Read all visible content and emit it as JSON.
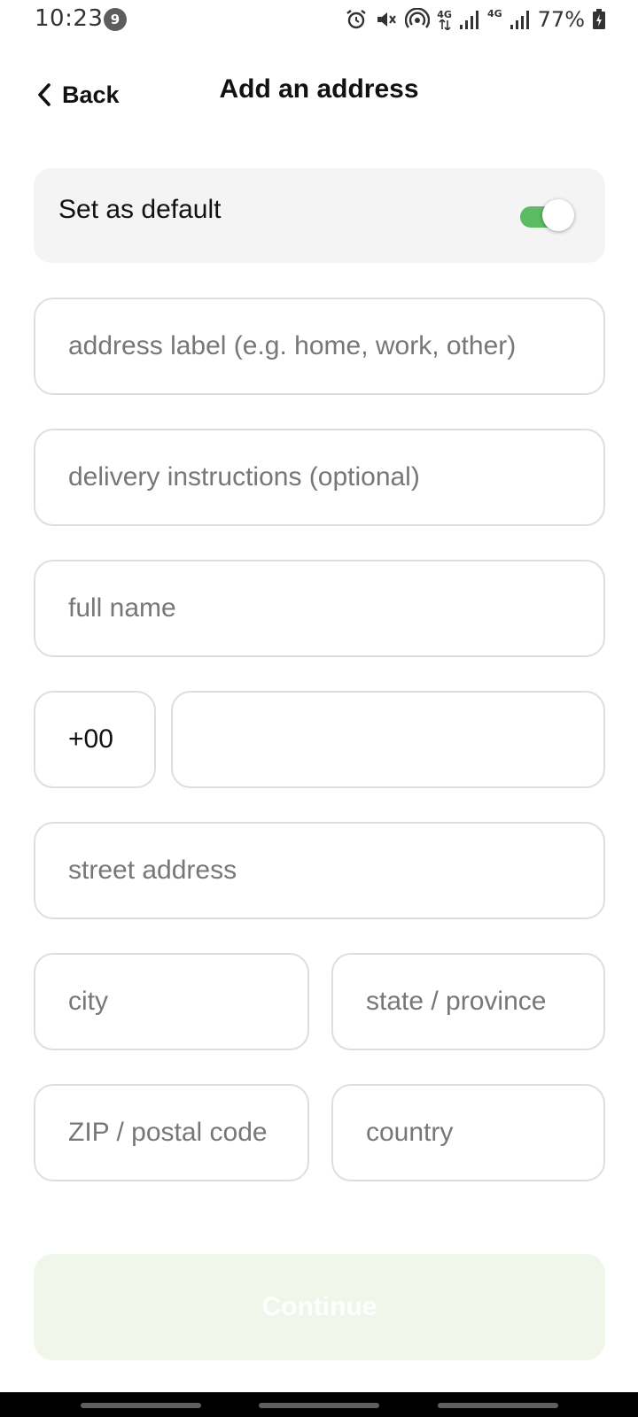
{
  "status_bar": {
    "time": "10:23",
    "notification_count": "9",
    "network_1": "4G",
    "network_2": "4G",
    "battery": "77%"
  },
  "header": {
    "back_label": "Back",
    "title": "Add an address"
  },
  "default_toggle": {
    "label": "Set as default",
    "on": true,
    "on_color": "#5cbb64"
  },
  "form": {
    "address_label": {
      "value": "",
      "placeholder": "address label (e.g. home, work, other)"
    },
    "delivery_instructions": {
      "value": "",
      "placeholder": "delivery instructions (optional)"
    },
    "full_name": {
      "value": "",
      "placeholder": "full name"
    },
    "country_code": {
      "value": "+00"
    },
    "phone": {
      "value": "",
      "placeholder": ""
    },
    "street_address": {
      "value": "",
      "placeholder": "street address"
    },
    "city": {
      "value": "",
      "placeholder": "city"
    },
    "state": {
      "value": "",
      "placeholder": "state / province"
    },
    "zip": {
      "value": "",
      "placeholder": "ZIP / postal code"
    },
    "country": {
      "value": "",
      "placeholder": "country"
    }
  },
  "continue": {
    "label": "Continue",
    "enabled": false,
    "background": "#f0f6e9"
  }
}
